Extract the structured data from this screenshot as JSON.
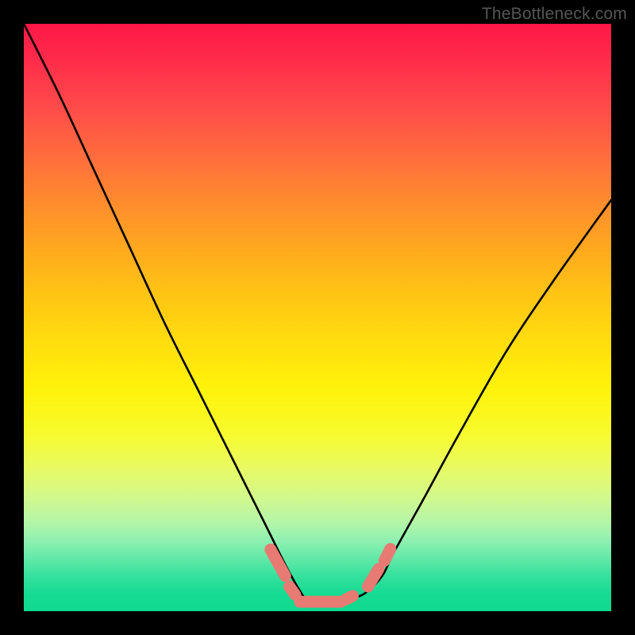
{
  "watermark": "TheBottleneck.com",
  "chart_data": {
    "type": "line",
    "title": "",
    "xlabel": "",
    "ylabel": "",
    "xlim": [
      0,
      100
    ],
    "ylim": [
      0,
      100
    ],
    "grid": false,
    "legend": false,
    "series": [
      {
        "name": "bottleneck-curve",
        "color": "#000000",
        "x": [
          0,
          6,
          12,
          18,
          24,
          30,
          36,
          41,
          45,
          48,
          50,
          52,
          55,
          58,
          61,
          63,
          68,
          74,
          82,
          90,
          100
        ],
        "values": [
          100,
          88,
          75,
          62,
          49,
          37,
          25,
          15,
          7,
          2,
          1,
          1,
          2,
          3,
          6,
          10,
          19,
          30,
          44,
          56,
          70
        ]
      },
      {
        "name": "optimal-range-markers",
        "color": "#e77b73",
        "style": "marker-segments",
        "segments": [
          {
            "x": [
              42.0,
              44.5
            ],
            "values": [
              10.5,
              6.0
            ]
          },
          {
            "x": [
              45.2,
              46.2
            ],
            "values": [
              4.2,
              2.8
            ]
          },
          {
            "x": [
              47.0,
              54.0
            ],
            "values": [
              1.6,
              1.6
            ]
          },
          {
            "x": [
              54.8,
              56.0
            ],
            "values": [
              2.0,
              2.6
            ]
          },
          {
            "x": [
              58.6,
              60.4
            ],
            "values": [
              4.2,
              7.2
            ]
          },
          {
            "x": [
              61.4,
              62.4
            ],
            "values": [
              8.6,
              10.6
            ]
          }
        ]
      }
    ]
  }
}
